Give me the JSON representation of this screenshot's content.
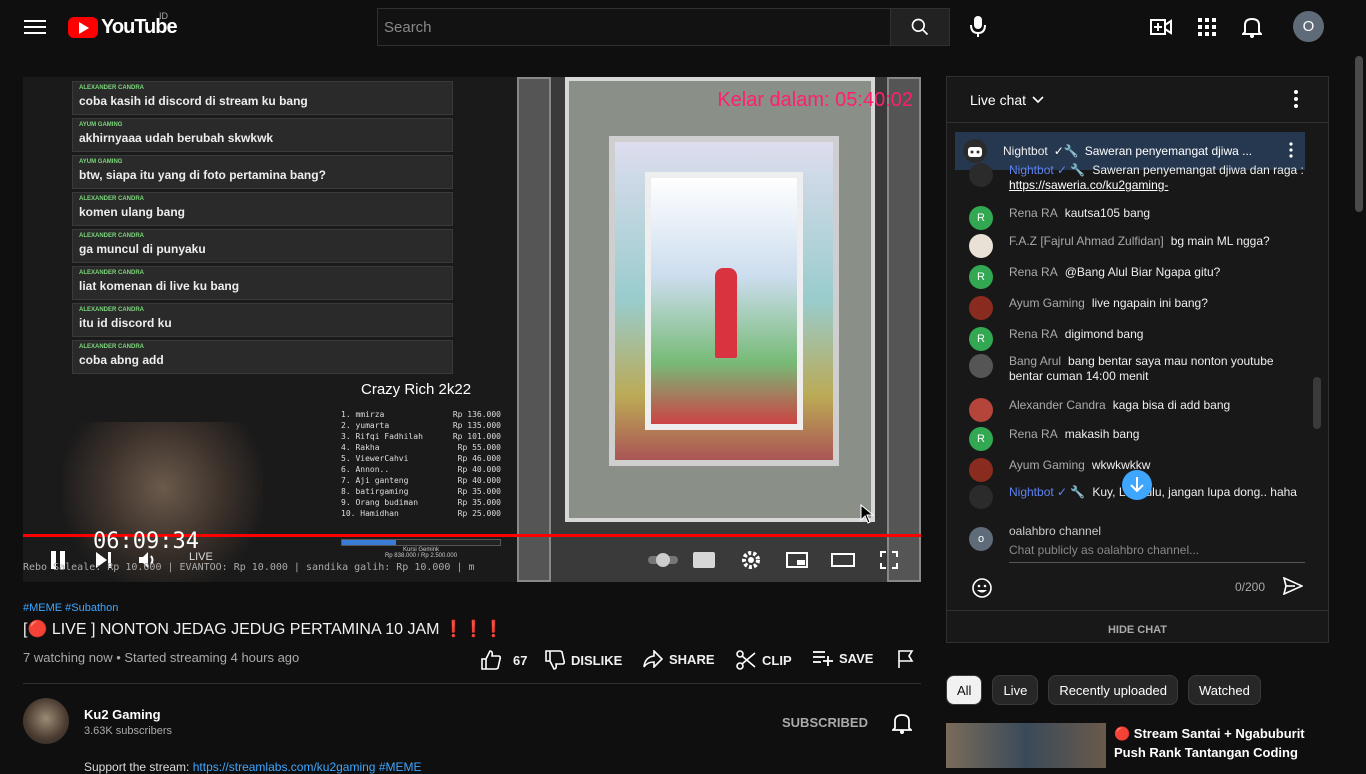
{
  "header": {
    "logo_text": "YouTube",
    "country_code": "ID",
    "search_placeholder": "Search",
    "user_initial": "O"
  },
  "player": {
    "overlay_chat": [
      {
        "name": "ALEXANDER CANDRA",
        "text": "coba kasih id discord di stream ku bang"
      },
      {
        "name": "AYUM GAMING",
        "text": "akhirnyaaa udah berubah skwkwk"
      },
      {
        "name": "AYUM GAMING",
        "text": "btw, siapa itu yang di foto pertamina bang?"
      },
      {
        "name": "ALEXANDER CANDRA",
        "text": "komen ulang bang"
      },
      {
        "name": "ALEXANDER CANDRA",
        "text": "ga muncul di punyaku"
      },
      {
        "name": "ALEXANDER CANDRA",
        "text": "liat komenan di live ku bang"
      },
      {
        "name": "ALEXANDER CANDRA",
        "text": "itu id discord ku"
      },
      {
        "name": "ALEXANDER CANDRA",
        "text": "coba abng add"
      }
    ],
    "leaderboard_title": "Crazy Rich 2k22",
    "leaderboard": [
      {
        "name": "1. mmirza",
        "amount": "Rp 136.000"
      },
      {
        "name": "2. yumarta",
        "amount": "Rp 135.000"
      },
      {
        "name": "3. Rifqi Fadhilah",
        "amount": "Rp 101.000"
      },
      {
        "name": "4. Rakha",
        "amount": "Rp 55.000"
      },
      {
        "name": "5. ViewerCahvi",
        "amount": "Rp 46.000"
      },
      {
        "name": "6. Annon..",
        "amount": "Rp 40.000"
      },
      {
        "name": "7. Aji ganteng",
        "amount": "Rp 40.000"
      },
      {
        "name": "8. batirgaming",
        "amount": "Rp 35.000"
      },
      {
        "name": "9. Orang budiman",
        "amount": "Rp 35.000"
      },
      {
        "name": "10. Hamidhan",
        "amount": "Rp 25.000"
      }
    ],
    "timer_text": "Kelar dalam: 05:40:02",
    "stream_time": "06:09:34",
    "live_label": "LIVE",
    "goal_label": "Kursi Gemink",
    "goal_amount": "Rp 838.000 / Rp 2.500.000",
    "goal_fraction": 0.34,
    "ticker": "Rebo Saleale: Rp 10.000 | EVANTOO: Rp 10.000 | sandika galih: Rp 10.000 | m"
  },
  "video": {
    "tags": "#MEME #Subathon",
    "title": "[🔴 LIVE ] NONTON JEDAG JEDUG PERTAMINA 10 JAM ❗❗❗",
    "stats": "7 watching now • Started streaming 4 hours ago",
    "likes": "67",
    "dislike_label": "DISLIKE",
    "share_label": "SHARE",
    "clip_label": "CLIP",
    "save_label": "SAVE"
  },
  "channel": {
    "name": "Ku2 Gaming",
    "subscribers": "3.63K subscribers",
    "subscribed_label": "SUBSCRIBED",
    "desc_prefix": "Support the stream: ",
    "desc_link": "https://streamlabs.com/ku2gaming",
    "desc_tag": "#MEME"
  },
  "chat": {
    "title": "Live chat",
    "pinned_author": "Nightbot",
    "pinned_text": "Saweran penyemangat djiwa ...",
    "messages": [
      {
        "author": "Nightbot",
        "mod": true,
        "text": "Saweran penyemangat djiwa dan raga : ",
        "link": "https://saweria.co/ku2gaming-",
        "color": "#2b2b2b",
        "initial": ""
      },
      {
        "author": "Rena RA",
        "mod": false,
        "text": "kautsa105 bang",
        "link": "",
        "color": "#33a852",
        "initial": "R"
      },
      {
        "author": "F.A.Z [Fajrul Ahmad Zulfidan]",
        "mod": false,
        "text": "bg main ML ngga?",
        "link": "",
        "color": "#e9e1d6",
        "initial": ""
      },
      {
        "author": "Rena RA",
        "mod": false,
        "text": "@Bang Alul Biar Ngapa gitu?",
        "link": "",
        "color": "#33a852",
        "initial": "R"
      },
      {
        "author": "Ayum Gaming",
        "mod": false,
        "text": "live ngapain ini bang?",
        "link": "",
        "color": "#8a2b1f",
        "initial": ""
      },
      {
        "author": "Rena RA",
        "mod": false,
        "text": "digimond bang",
        "link": "",
        "color": "#33a852",
        "initial": "R"
      },
      {
        "author": "Bang Arul",
        "mod": false,
        "text": "bang bentar saya mau nonton youtube bentar cuman 14:00 menit",
        "link": "",
        "color": "#555555",
        "initial": ""
      },
      {
        "author": "Alexander Candra",
        "mod": false,
        "text": "kaga bisa di add bang",
        "link": "",
        "color": "#b5453a",
        "initial": ""
      },
      {
        "author": "Rena RA",
        "mod": false,
        "text": "makasih bang",
        "link": "",
        "color": "#33a852",
        "initial": "R"
      },
      {
        "author": "Ayum Gaming",
        "mod": false,
        "text": "wkwkwkkw",
        "link": "",
        "color": "#8a2b1f",
        "initial": ""
      },
      {
        "author": "Nightbot",
        "mod": true,
        "text": "Kuy, L... dulu, jangan lupa dong.. haha",
        "link": "",
        "color": "#2b2b2b",
        "initial": ""
      }
    ],
    "input_user": "oalahbro channel",
    "input_initial": "o",
    "input_placeholder": "Chat publicly as oalahbro channel...",
    "char_count": "0/200",
    "hide_label": "HIDE CHAT"
  },
  "filters": [
    "All",
    "Live",
    "Recently uploaded",
    "Watched"
  ],
  "recommendation": {
    "title": "🔴 Stream Santai + Ngabuburit Push Rank Tantangan Coding"
  }
}
